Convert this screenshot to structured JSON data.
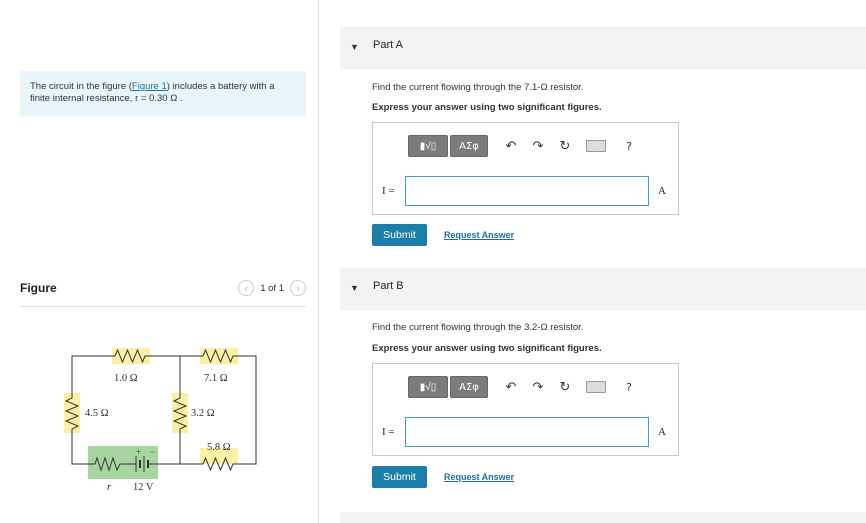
{
  "problem": {
    "intro_pre": "The circuit in the figure (",
    "intro_link": "Figure 1",
    "intro_post": ") includes a battery with a finite internal resistance, r = 0.30 Ω ."
  },
  "figure": {
    "title": "Figure",
    "pager": "1 of 1",
    "prev_icon": "chevron-left-icon",
    "next_icon": "chevron-right-icon",
    "circuit": {
      "labels": {
        "r1": "1.0 Ω",
        "r2": "7.1 Ω",
        "r3": "4.5 Ω",
        "r4": "3.2 Ω",
        "r5": "5.8 Ω",
        "r_internal": "r",
        "emf": "12 V",
        "plus": "+",
        "minus": "−"
      },
      "colors": {
        "resistor_highlight": "#fbf0a6",
        "battery_highlight": "#a7d5a0"
      }
    }
  },
  "parts": [
    {
      "title": "Part A",
      "question": "Find the current flowing through the 7.1-Ω resistor.",
      "instruction": "Express your answer using two significant figures.",
      "var_label": "I =",
      "answer_value": "",
      "unit": "A",
      "submit": "Submit",
      "request": "Request Answer"
    },
    {
      "title": "Part B",
      "question": "Find the current flowing through the 3.2-Ω resistor.",
      "instruction": "Express your answer using two significant figures.",
      "var_label": "I =",
      "answer_value": "",
      "unit": "A",
      "submit": "Submit",
      "request": "Request Answer"
    }
  ],
  "toolbar": {
    "template_label": "▮√▯",
    "greek_label": "ΑΣφ",
    "undo": "↶",
    "redo": "↷",
    "reset": "↻",
    "help": "?"
  },
  "colors": {
    "submit": "#1a7ea8",
    "link": "#1d6fa5",
    "intro_bg": "#e8f6fb",
    "part_header_bg": "#f3f3f3"
  }
}
